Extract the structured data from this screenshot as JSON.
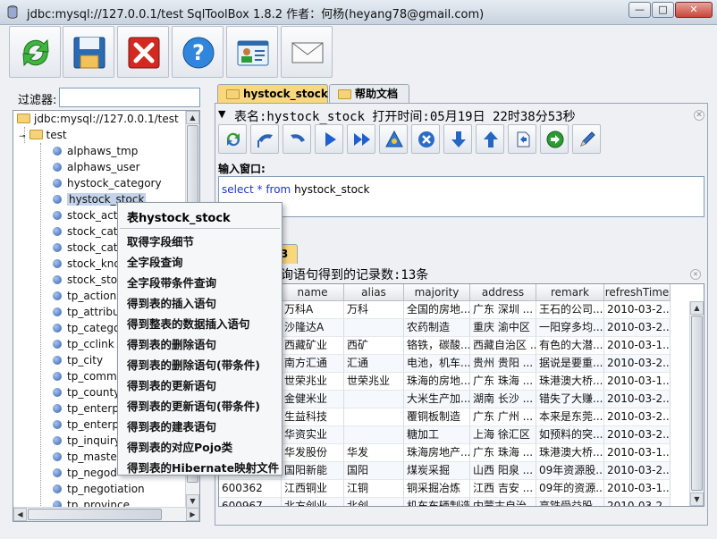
{
  "window": {
    "title": "jdbc:mysql://127.0.0.1/test SqlToolBox 1.8.2 作者：何杨(heyang78@gmail.com)",
    "controls": [
      "—",
      "□",
      "✕"
    ]
  },
  "toolbar": {
    "buttons": [
      "refresh-icon",
      "save-icon",
      "close-icon",
      "help-icon",
      "contact-card-icon",
      "mail-icon"
    ]
  },
  "filter": {
    "label": "过滤器:",
    "value": ""
  },
  "tree": {
    "root": "jdbc:mysql://127.0.0.1/test",
    "schema": "test",
    "items": [
      "alphaws_tmp",
      "alphaws_user",
      "hystock_category",
      "hystock_stock",
      "stock_acti",
      "stock_cate",
      "stock_cate",
      "stock_kno",
      "stock_sto",
      "tp_actionm",
      "tp_attribut",
      "tp_catego",
      "tp_cclink",
      "tp_city",
      "tp_comme",
      "tp_county",
      "tp_enterpr",
      "tp_enterpr",
      "tp_inquiry",
      "tp_master",
      "tp_negod",
      "tp_negotiation",
      "tp_province"
    ],
    "selected_index": 3
  },
  "tabs": [
    {
      "label": "hystock_stock",
      "active": true
    },
    {
      "label": "帮助文档",
      "active": false
    }
  ],
  "table_panel": {
    "header": "表名:hystock_stock 打开时间:05月19日 22时38分53秒",
    "input_label": "输入窗口:",
    "sql": {
      "kw1": "select",
      "star": "*",
      "kw2": "from",
      "table": "hystock_stock"
    },
    "result_tab": "3",
    "result_info": "询语句得到的记录数:13条"
  },
  "grid": {
    "columns": [
      "name",
      "alias",
      "majority",
      "address",
      "remark",
      "refreshTime"
    ],
    "rows": [
      [
        "",
        "万科A",
        "万科",
        "全国的房地...",
        "广东 深圳 ...",
        "王石的公司...",
        "2010-03-2..."
      ],
      [
        "",
        "沙隆达A",
        "",
        "农药制造",
        "重庆 渝中区",
        "一阳穿多均...",
        "2010-03-2..."
      ],
      [
        "",
        "西藏矿业",
        "西矿",
        "铬铁，碳酸...",
        "西藏自治区 ...",
        "有色的大潜...",
        "2010-03-1..."
      ],
      [
        "",
        "南方汇通",
        "汇通",
        "电池，机车...",
        "贵州 贵阳 ...",
        "据说是要重...",
        "2010-03-2..."
      ],
      [
        "",
        "世荣兆业",
        "世荣兆业",
        "珠海的房地...",
        "广东 珠海 ...",
        "珠港澳大桥...",
        "2010-03-1..."
      ],
      [
        "",
        "金健米业",
        "",
        "大米生产加...",
        "湖南 长沙 ...",
        "错失了大赚...",
        "2010-03-2..."
      ],
      [
        "",
        "生益科技",
        "",
        "覆铜板制造",
        "广东 广州 ...",
        "本来是东莞...",
        "2010-03-2..."
      ],
      [
        "",
        "华资实业",
        "",
        "糖加工",
        "上海 徐汇区",
        "如预料的突...",
        "2010-03-2..."
      ],
      [
        "",
        "华发股份",
        "华发",
        "珠海房地产...",
        "广东 珠海 ...",
        "珠港澳大桥...",
        "2010-03-1..."
      ],
      [
        "",
        "国阳新能",
        "国阳",
        "煤炭采掘",
        "山西 阳泉 ...",
        "09年资源股...",
        "2010-03-2..."
      ],
      [
        "600362",
        "江西铜业",
        "江铜",
        "铜采掘冶炼",
        "江西 吉安 ...",
        "09年的资源...",
        "2010-03-1..."
      ],
      [
        "600967",
        "北方创业",
        "北创",
        "机车车辆制造",
        "内蒙古自治...",
        "高铁受益股...",
        "2010-03-2..."
      ]
    ]
  },
  "context_menu": {
    "header": "表hystock_stock",
    "items": [
      "取得字段细节",
      "全字段查询",
      "全字段带条件查询",
      "得到表的插入语句",
      "得到整表的数据插入语句",
      "得到表的删除语句",
      "得到表的删除语句(带条件)",
      "得到表的更新语句",
      "得到表的更新语句(带条件)",
      "得到表的建表语句",
      "得到表的对应Pojo类",
      "得到表的Hibernate映射文件"
    ]
  }
}
